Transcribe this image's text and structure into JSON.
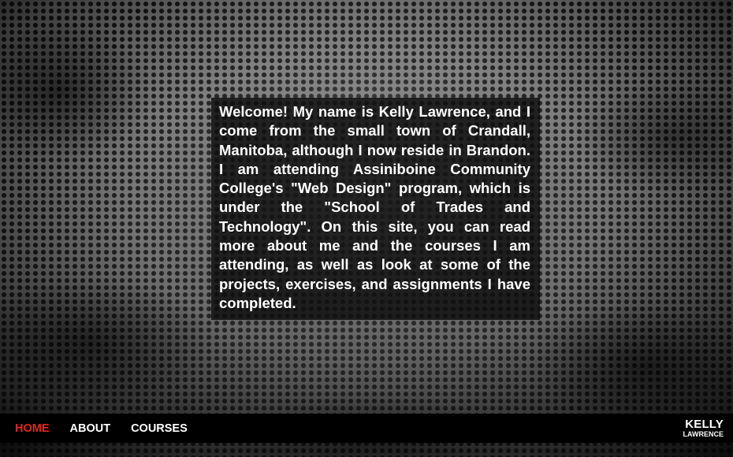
{
  "intro": {
    "text": "Welcome! My name is Kelly Lawrence, and I come from the small town of Crandall, Manitoba, although I now reside in Brandon. I am attending Assiniboine Community College's \"Web Design\" program, which is under the \"School of Trades and Technology\". On this site, you can read more about me and the courses I am attending, as well as look at some of the projects, exercises, and assignments I have completed."
  },
  "nav": {
    "items": [
      {
        "label": "HOME",
        "active": true
      },
      {
        "label": "ABOUT",
        "active": false
      },
      {
        "label": "COURSES",
        "active": false
      }
    ]
  },
  "logo": {
    "first": "KELLY",
    "last": "LAWRENCE"
  },
  "colors": {
    "nav_active": "#e0281f",
    "nav_default": "#ffffff",
    "navbar_bg": "#000000",
    "text_box_bg": "#0c0c0c"
  },
  "background": {
    "pattern": "perforated-metal-grunge"
  }
}
